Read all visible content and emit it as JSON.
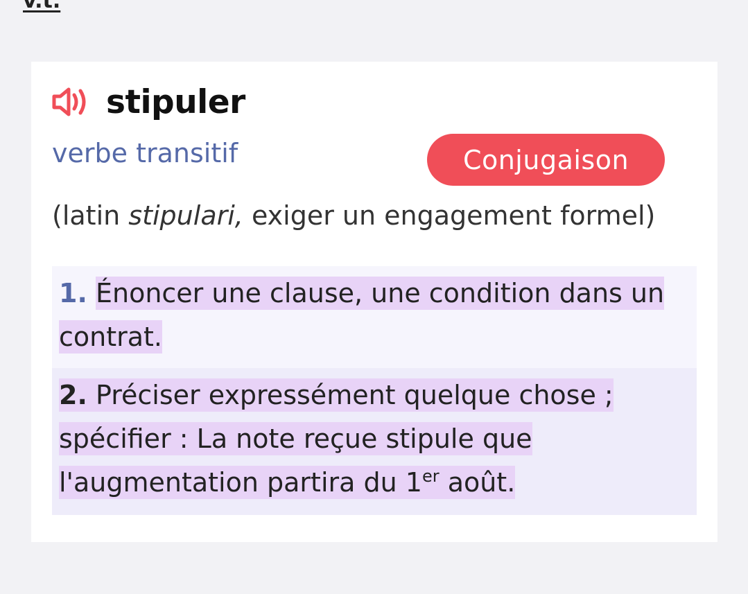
{
  "top_abbreviation": "v.t.",
  "entry": {
    "headword": "stipuler",
    "part_of_speech": "verbe transitif",
    "conjugation_button_label": "Conjugaison",
    "etymology": {
      "prefix": "(latin ",
      "latin_word": "stipulari,",
      "suffix": " exiger un engagement formel)"
    },
    "definitions": [
      {
        "number": "1.",
        "text": "Énoncer une clause, une condition dans un contrat."
      },
      {
        "number": "2.",
        "text_part1": "Préciser expressément quelque chose ; spécifier : La note reçue stipule que l'augmentation partira du 1",
        "superscript": "er",
        "text_part2": " août."
      }
    ]
  },
  "colors": {
    "accent_red": "#f04e58",
    "pos_blue": "#5569a8",
    "highlight": "#e8d3f7"
  },
  "icons": {
    "audio": "speaker-icon"
  }
}
